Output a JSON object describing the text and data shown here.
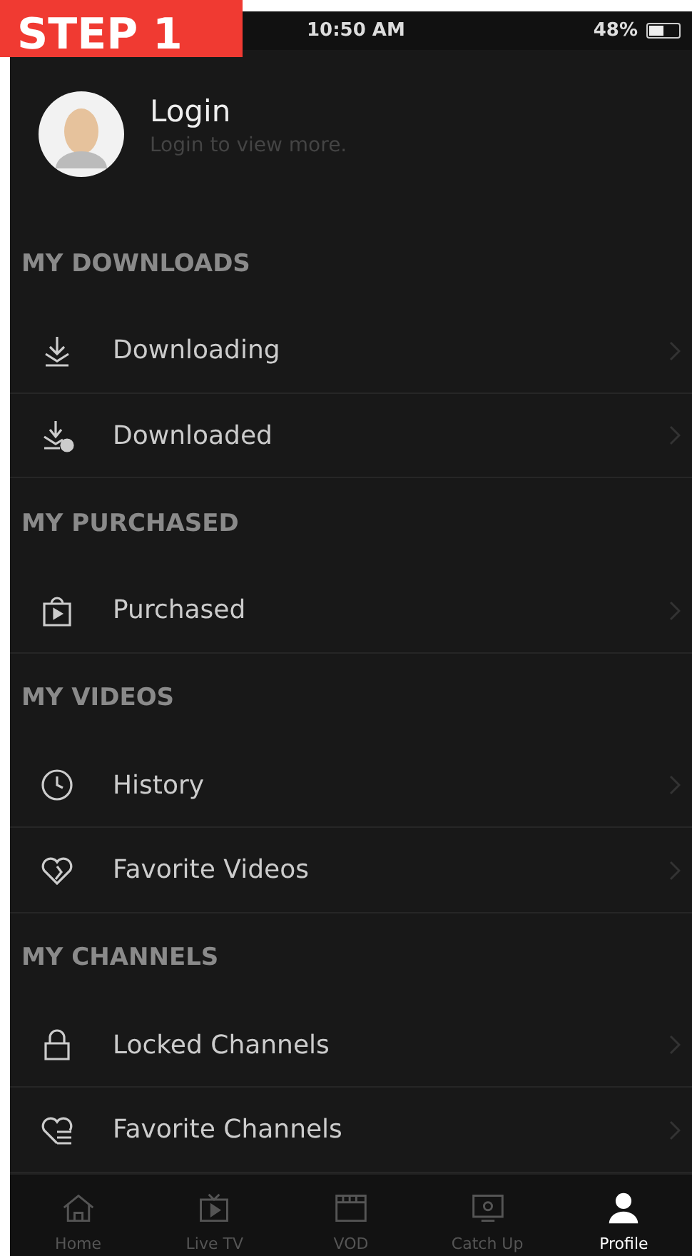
{
  "badge": "STEP 1",
  "status_bar": {
    "time": "10:50 AM",
    "battery": "48%"
  },
  "profile": {
    "title": "Login",
    "subtitle": "Login to view more."
  },
  "sections": [
    {
      "heading": "MY DOWNLOADS",
      "items": [
        {
          "label": "Downloading"
        },
        {
          "label": "Downloaded"
        }
      ]
    },
    {
      "heading": "MY PURCHASED",
      "items": [
        {
          "label": "Purchased"
        }
      ]
    },
    {
      "heading": "MY VIDEOS",
      "items": [
        {
          "label": "History"
        },
        {
          "label": "Favorite Videos"
        }
      ]
    },
    {
      "heading": "MY CHANNELS",
      "items": [
        {
          "label": "Locked Channels"
        },
        {
          "label": "Favorite Channels"
        }
      ]
    }
  ],
  "tabs": [
    {
      "label": "Home",
      "selected": false
    },
    {
      "label": "Live TV",
      "selected": false
    },
    {
      "label": "VOD",
      "selected": false
    },
    {
      "label": "Catch Up",
      "selected": false
    },
    {
      "label": "Profile",
      "selected": true
    }
  ]
}
